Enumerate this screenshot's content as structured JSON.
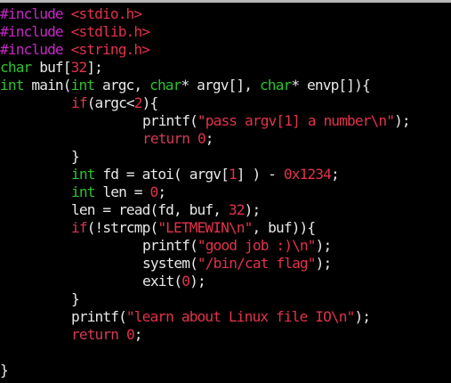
{
  "editor": {
    "lines": {
      "l1": {
        "a": "#include ",
        "b": "<stdio.h>"
      },
      "l2": {
        "a": "#include ",
        "b": "<stdlib.h>"
      },
      "l3": {
        "a": "#include ",
        "b": "<string.h>"
      },
      "l4": {
        "a": "char",
        "b": " buf[",
        "c": "32",
        "d": "];"
      },
      "l5": {
        "a": "int",
        "b": " main(",
        "c": "int",
        "d": " argc, ",
        "e": "char",
        "f": "* argv[], ",
        "g": "char",
        "h": "* envp[]){"
      },
      "l6": {
        "a": "if",
        "b": "(argc<",
        "c": "2",
        "d": "){"
      },
      "l7": {
        "a": "printf(",
        "b": "\"pass argv[1] a number\\n\"",
        "c": ");"
      },
      "l8": {
        "a": "return",
        "b": " ",
        "c": "0",
        "d": ";"
      },
      "l9": {
        "a": "}"
      },
      "l10": {
        "a": "int",
        "b": " fd = atoi( argv[",
        "c": "1",
        "d": "] ) - ",
        "e": "0x1234",
        "f": ";"
      },
      "l11": {
        "a": "int",
        "b": " len = ",
        "c": "0",
        "d": ";"
      },
      "l12": {
        "a": "len = read(fd, buf, ",
        "b": "32",
        "c": ");"
      },
      "l13": {
        "a": "if",
        "b": "(!strcmp(",
        "c": "\"LETMEWIN\\n\"",
        "d": ", buf)){"
      },
      "l14": {
        "a": "printf(",
        "b": "\"good job :)\\n\"",
        "c": ");"
      },
      "l15": {
        "a": "system(",
        "b": "\"/bin/cat flag\"",
        "c": ");"
      },
      "l16": {
        "a": "exit(",
        "b": "0",
        "c": ");"
      },
      "l17": {
        "a": "}"
      },
      "l18": {
        "a": "printf(",
        "b": "\"learn about Linux file IO\\n\"",
        "c": ");"
      },
      "l19": {
        "a": "return",
        "b": " ",
        "c": "0",
        "d": ";"
      },
      "l20": {
        "a": ""
      },
      "l21": {
        "a": "}"
      }
    },
    "colors": {
      "background": "#000000",
      "preprocessor": "#c728c7",
      "string": "#e2324b",
      "type": "#2fc12f",
      "keyword": "#d23a55",
      "plain": "#e8e8e8"
    }
  }
}
